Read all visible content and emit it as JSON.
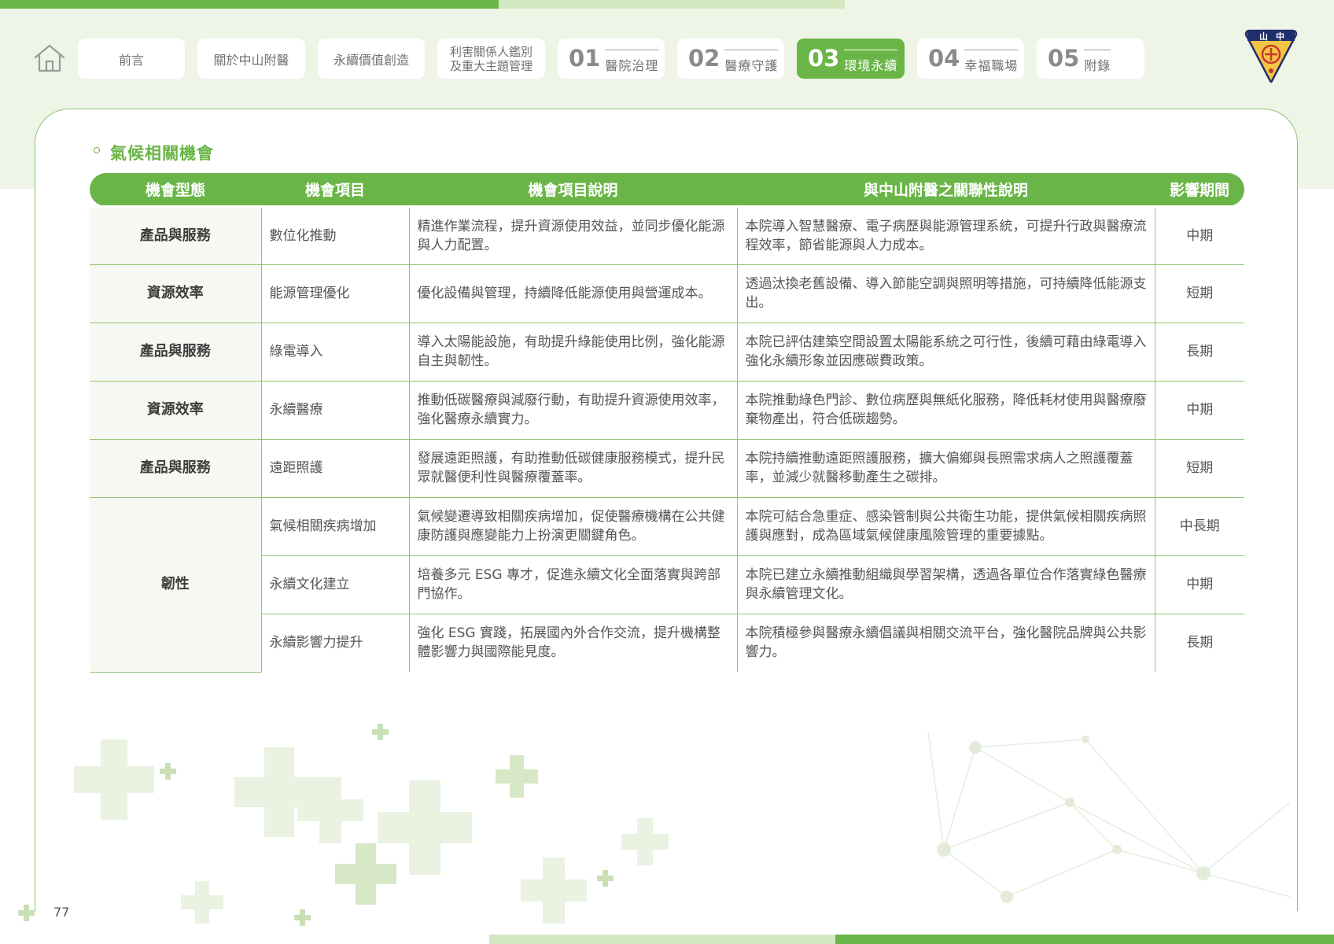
{
  "nav": {
    "tabs": [
      {
        "label": "前言"
      },
      {
        "label": "關於中山附醫"
      },
      {
        "label": "永續價值創造"
      },
      {
        "line1": "利害關係人鑑別",
        "line2": "及重大主題管理"
      },
      {
        "num": "01",
        "label": "醫院治理"
      },
      {
        "num": "02",
        "label": "醫療守護"
      },
      {
        "num": "03",
        "label": "環境永續"
      },
      {
        "num": "04",
        "label": "幸福職場"
      },
      {
        "num": "05",
        "label": "附錄"
      }
    ],
    "active_tab": "03"
  },
  "logo": {
    "text_left": "山",
    "text_right": "中"
  },
  "section": {
    "title": "氣候相關機會"
  },
  "table": {
    "headers": [
      "機會型態",
      "機會項目",
      "機會項目說明",
      "與中山附醫之關聯性說明",
      "影響期間"
    ],
    "rows": [
      {
        "type": "產品與服務",
        "item": "數位化推動",
        "desc": "精進作業流程，提升資源使用效益，並同步優化能源與人力配置。",
        "relation": "本院導入智慧醫療、電子病歷與能源管理系統，可提升行政與醫療流程效率，節省能源與人力成本。",
        "period": "中期"
      },
      {
        "type": "資源效率",
        "item": "能源管理優化",
        "desc": "優化設備與管理，持續降低能源使用與營運成本。",
        "relation": "透過汰換老舊設備、導入節能空調與照明等措施，可持續降低能源支出。",
        "period": "短期"
      },
      {
        "type": "產品與服務",
        "item": "綠電導入",
        "desc": "導入太陽能設施，有助提升綠能使用比例，強化能源自主與韌性。",
        "relation": "本院已評估建築空間設置太陽能系統之可行性，後續可藉由綠電導入強化永續形象並因應碳費政策。",
        "period": "長期"
      },
      {
        "type": "資源效率",
        "item": "永續醫療",
        "desc": "推動低碳醫療與減廢行動，有助提升資源使用效率，強化醫療永續實力。",
        "relation": "本院推動綠色門診、數位病歷與無紙化服務，降低耗材使用與醫療廢棄物產出，符合低碳趨勢。",
        "period": "中期"
      },
      {
        "type": "產品與服務",
        "item": "遠距照護",
        "desc": "發展遠距照護，有助推動低碳健康服務模式，提升民眾就醫便利性與醫療覆蓋率。",
        "relation": "本院持續推動遠距照護服務，擴大偏鄉與長照需求病人之照護覆蓋率，並減少就醫移動產生之碳排。",
        "period": "短期"
      },
      {
        "type": "韌性",
        "item": "氣候相關疾病增加",
        "desc": "氣候變遷導致相關疾病增加，促使醫療機構在公共健康防護與應變能力上扮演更關鍵角色。",
        "relation": "本院可結合急重症、感染管制與公共衛生功能，提供氣候相關疾病照護與應對，成為區域氣候健康風險管理的重要據點。",
        "period": "中長期"
      },
      {
        "type": "",
        "item": "永續文化建立",
        "desc": "培養多元 ESG 專才，促進永續文化全面落實與跨部門協作。",
        "relation": "本院已建立永續推動組織與學習架構，透過各單位合作落實綠色醫療與永續管理文化。",
        "period": "中期"
      },
      {
        "type": "",
        "item": "永續影響力提升",
        "desc": "強化 ESG 實踐，拓展國內外合作交流，提升機構整體影響力與國際能見度。",
        "relation": "本院積極參與醫療永續倡議與相關交流平台，強化醫院品牌與公共影響力。",
        "period": "長期"
      }
    ]
  },
  "page_number": "77",
  "colors": {
    "accent": "#6ab547",
    "accent_light": "#d3e8c1",
    "band": "#eef4e6",
    "border": "#8dc672"
  }
}
